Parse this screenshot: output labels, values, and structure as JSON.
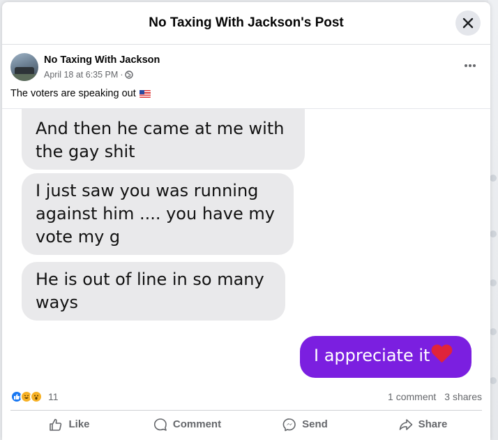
{
  "dialog": {
    "title": "No Taxing With Jackson's Post"
  },
  "post": {
    "author": "No Taxing With Jackson",
    "timestamp": "April 18 at 6:35 PM",
    "separator": "·",
    "privacy_icon": "globe-icon",
    "text": "The voters are speaking out",
    "text_emoji": "us-flag"
  },
  "messages": [
    {
      "side": "received",
      "text": "And then he came at me with the gay shit"
    },
    {
      "side": "received",
      "text": "I just saw you was running against him .... you have my vote my g"
    },
    {
      "side": "received",
      "text": "He is out of line in so many ways"
    },
    {
      "side": "sent",
      "text": "I appreciate it",
      "emoji": "red-heart"
    }
  ],
  "stats": {
    "reaction_icons": [
      "like",
      "haha",
      "wow"
    ],
    "reaction_count": "11",
    "comments": "1 comment",
    "shares": "3 shares"
  },
  "actions": {
    "like": "Like",
    "comment": "Comment",
    "send": "Send",
    "share": "Share"
  },
  "colors": {
    "sent_bubble": "#7b1fe0",
    "received_bubble": "#e9e9eb",
    "like_blue": "#1877f2"
  }
}
